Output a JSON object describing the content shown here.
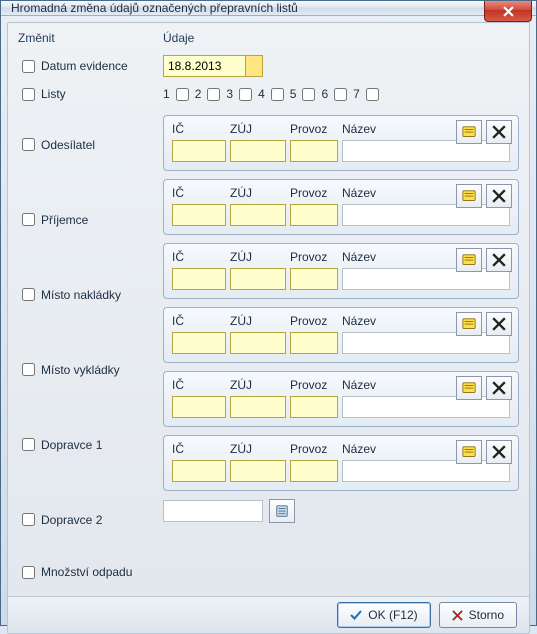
{
  "window": {
    "title": "Hromadná změna údajů označených přepravních listů"
  },
  "labels": {
    "zmenit": "Změnit",
    "udaje": "Údaje",
    "datum_evidence": "Datum evidence",
    "listy": "Listy",
    "odesilatel": "Odesílatel",
    "prijemce": "Příjemce",
    "misto_nakladky": "Místo nakládky",
    "misto_vykladky": "Místo vykládky",
    "dopravce1": "Dopravce 1",
    "dopravce2": "Dopravce 2",
    "mnozstvi_odpadu": "Množství odpadu"
  },
  "date": {
    "value": "18.8.2013"
  },
  "listy_numbers": [
    "1",
    "2",
    "3",
    "4",
    "5",
    "6",
    "7"
  ],
  "party_headers": {
    "ic": "IČ",
    "zuj": "ZÚJ",
    "provoz": "Provoz",
    "nazev": "Název"
  },
  "parties": {
    "odesilatel": {
      "ic": "",
      "zuj": "",
      "provoz": "",
      "nazev": ""
    },
    "prijemce": {
      "ic": "",
      "zuj": "",
      "provoz": "",
      "nazev": ""
    },
    "misto_nakladky": {
      "ic": "",
      "zuj": "",
      "provoz": "",
      "nazev": ""
    },
    "misto_vykladky": {
      "ic": "",
      "zuj": "",
      "provoz": "",
      "nazev": ""
    },
    "dopravce1": {
      "ic": "",
      "zuj": "",
      "provoz": "",
      "nazev": ""
    },
    "dopravce2": {
      "ic": "",
      "zuj": "",
      "provoz": "",
      "nazev": ""
    }
  },
  "mnozstvi": {
    "value": ""
  },
  "buttons": {
    "ok": "OK (F12)",
    "storno": "Storno"
  }
}
